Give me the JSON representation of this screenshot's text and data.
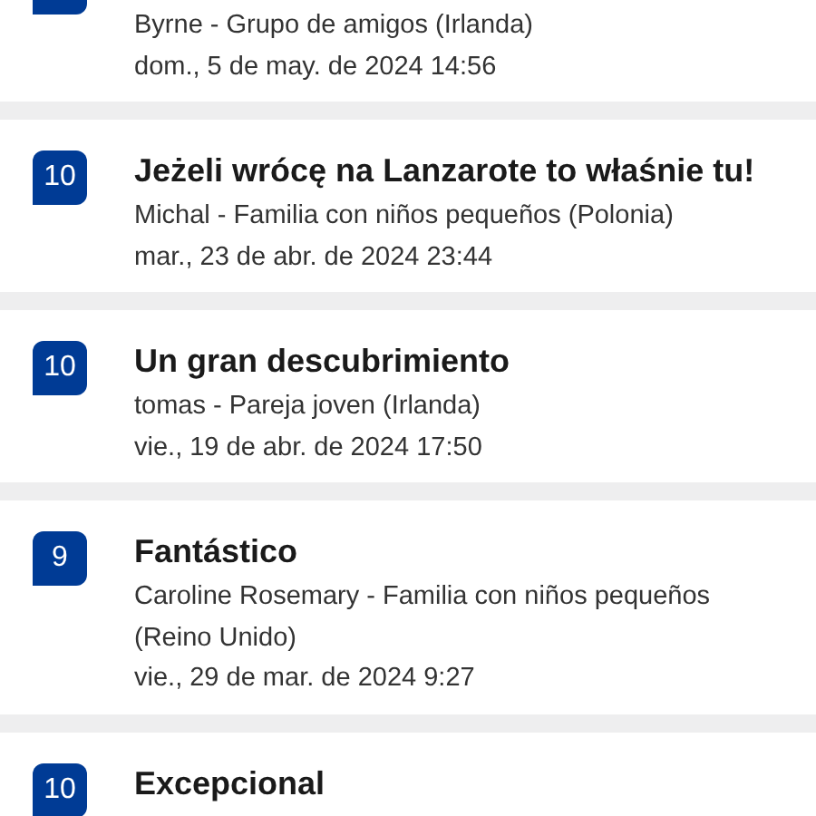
{
  "reviews": [
    {
      "author_line": "Byrne - Grupo de amigos (Irlanda)",
      "date": "dom., 5 de may. de 2024 14:56"
    },
    {
      "score": "10",
      "title": "Jeżeli wrócę na Lanzarote to właśnie tu!",
      "author_line": "Michal - Familia con niños pequeños (Polonia)",
      "date": "mar., 23 de abr. de 2024 23:44"
    },
    {
      "score": "10",
      "title": "Un gran descubrimiento",
      "author_line": "tomas - Pareja joven (Irlanda)",
      "date": "vie., 19 de abr. de 2024 17:50"
    },
    {
      "score": "9",
      "title": "Fantástico",
      "author_line": "Caroline Rosemary - Familia con niños pequeños (Reino Unido)",
      "date": "vie., 29 de mar. de 2024 9:27"
    },
    {
      "score": "10",
      "title": "Excepcional"
    }
  ]
}
